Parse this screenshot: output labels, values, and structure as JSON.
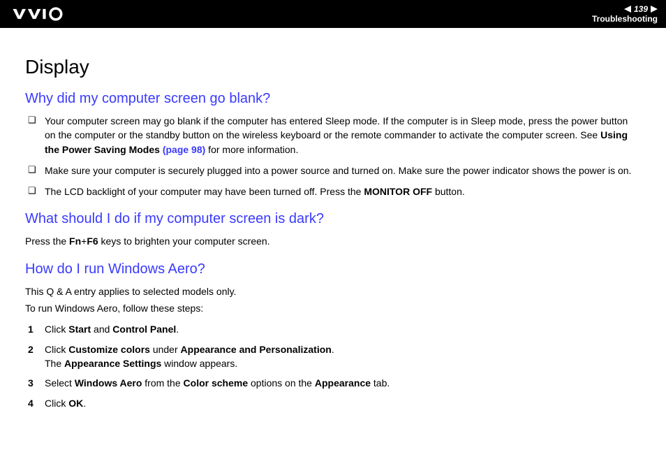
{
  "header": {
    "page_number": "139",
    "section": "Troubleshooting"
  },
  "page_title": "Display",
  "q1": {
    "heading": "Why did my computer screen go blank?",
    "items": [
      {
        "pre": "Your computer screen may go blank if the computer has entered Sleep mode. If the computer is in Sleep mode, press the power button on the computer or the standby button on the wireless keyboard or the remote commander to activate the computer screen. See ",
        "bold1": "Using the Power Saving Modes ",
        "link": "(page 98)",
        "post": " for more information."
      },
      {
        "text": "Make sure your computer is securely plugged into a power source and turned on. Make sure the power indicator shows the power is on."
      },
      {
        "pre": "The LCD backlight of your computer may have been turned off. Press the ",
        "bold1": "MONITOR OFF",
        "post": " button."
      }
    ]
  },
  "q2": {
    "heading": "What should I do if my computer screen is dark?",
    "body_pre": "Press the ",
    "body_bold": "Fn",
    "body_mid": "+",
    "body_bold2": "F6",
    "body_post": " keys to brighten your computer screen."
  },
  "q3": {
    "heading": "How do I run Windows Aero?",
    "intro1": "This Q & A entry applies to selected models only.",
    "intro2": "To run Windows Aero, follow these steps:",
    "steps": [
      {
        "pre": "Click ",
        "b1": "Start",
        "mid": " and ",
        "b2": "Control Panel",
        "post": "."
      },
      {
        "pre": "Click ",
        "b1": "Customize colors",
        "mid": " under ",
        "b2": "Appearance and Personalization",
        "post": ".",
        "line2_pre": "The ",
        "line2_b": "Appearance Settings",
        "line2_post": " window appears."
      },
      {
        "pre": "Select ",
        "b1": "Windows Aero",
        "mid": " from the ",
        "b2": "Color scheme",
        "mid2": " options on the ",
        "b3": "Appearance",
        "post": " tab."
      },
      {
        "pre": "Click ",
        "b1": "OK",
        "post": "."
      }
    ]
  }
}
